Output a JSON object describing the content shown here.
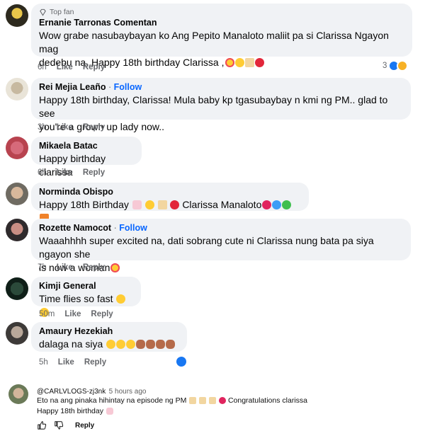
{
  "comments": [
    {
      "badge": "Top fan",
      "name": "Ernanie Tarronas Comentan",
      "lines": [
        "Wow grabe nasubaybayan ko Ang Pepito Manaloto maliit pa si Clarissa Ngayon mag",
        "dedebu na..Happy 18th birthday Clarissa ,"
      ],
      "time": "6h",
      "like": "Like",
      "reply": "Reply",
      "reaction_count": "3"
    },
    {
      "name": "Rei Mejia Leaño",
      "follow": "Follow",
      "lines": [
        "Happy 18th birthday, Clarissa! Mula baby kp tgasubaybay n kmi ng PM.. glad to see",
        "you're a grown up lady now.."
      ],
      "time": "3h",
      "like": "Like",
      "reply": "Reply"
    },
    {
      "name": "Mikaela Batac",
      "lines": [
        "Happy birthday clarissa"
      ],
      "time": "6h",
      "like": "Like",
      "reply": "Reply"
    },
    {
      "name": "Norminda Obispo",
      "lines": [
        "Happy 18th Birthday",
        "Clarissa Manaloto"
      ],
      "time": "",
      "like": "",
      "reply": ""
    },
    {
      "name": "Rozette Namocot",
      "follow": "Follow",
      "lines": [
        "Waaahhhh super excited na, dati sobrang cute ni Clarissa nung bata pa siya ngayon she",
        "is now a woman"
      ],
      "time": "7h",
      "like": "Like",
      "reply": "Reply"
    },
    {
      "name": "Kimji General",
      "lines": [
        "Time flies so fast"
      ],
      "time": "50m",
      "like": "Like",
      "reply": "Reply"
    },
    {
      "name": "Amaury Hezekiah",
      "lines": [
        "dalaga na siya"
      ],
      "time": "5h",
      "like": "Like",
      "reply": "Reply"
    }
  ],
  "youtube": {
    "handle": "@CARLVLOGS-zj3nk",
    "time": "5 hours ago",
    "line1": "Eto na ang pinaka hihintay na episode ng PM",
    "line1b": "Congratulations clarissa",
    "line2": "Happy 18th birthday",
    "reply": "Reply"
  },
  "colors": {
    "bubble": "#f0f2f5",
    "meta": "#65676b",
    "follow": "#0866ff",
    "like_reaction": "#1877f2",
    "haha_reaction": "#f7b125"
  }
}
